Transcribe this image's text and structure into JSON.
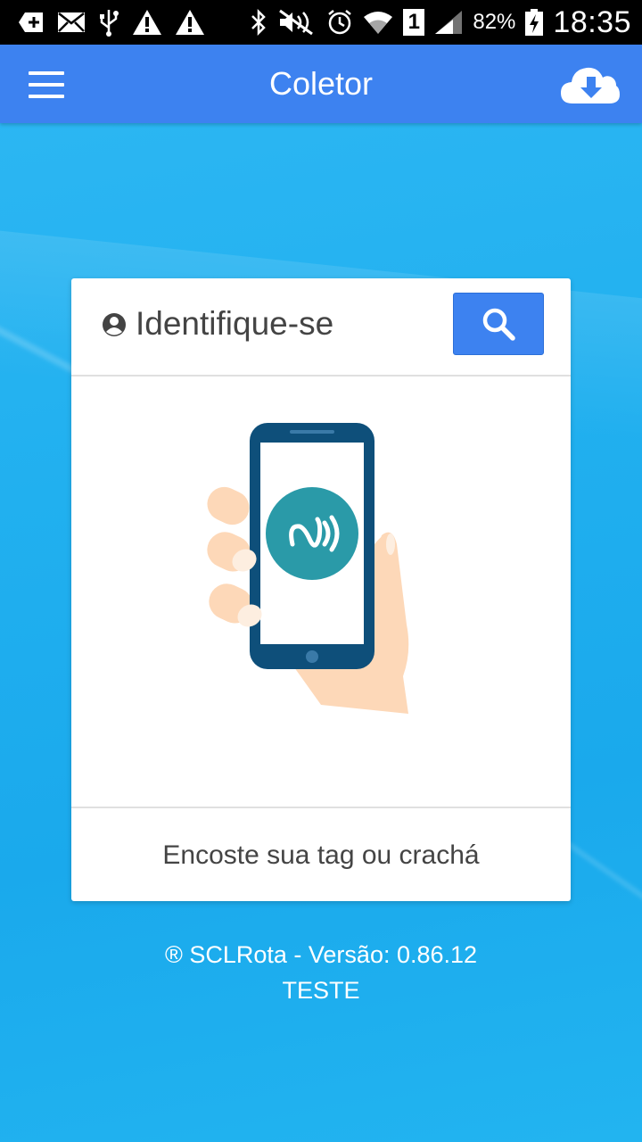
{
  "status_bar": {
    "battery": "82%",
    "time": "18:35",
    "sim": "1",
    "icons": [
      "plus-box-icon",
      "mail-icon",
      "usb-icon",
      "warning-icon",
      "warning-icon",
      "bluetooth-icon",
      "mute-icon",
      "alarm-icon",
      "wifi-icon",
      "signal-icon",
      "battery-charging-icon"
    ]
  },
  "app_bar": {
    "title": "Coletor",
    "menu_icon": "hamburger-menu-icon",
    "action_icon": "cloud-download-icon"
  },
  "card": {
    "title": "Identifique-se",
    "title_icon": "user-circle-icon",
    "search_icon": "search-icon",
    "illustration": "hand-phone-nfc-icon",
    "footer": "Encoste sua tag ou crachá"
  },
  "footer": {
    "version": "® SCLRota - Versão: 0.86.12",
    "environment": "TESTE"
  },
  "colors": {
    "app_bar": "#3d82f0",
    "background": "#1fb0ee",
    "nfc_circle": "#2a9aa8",
    "phone_body": "#0e4f7a",
    "hand": "#fdd8b8"
  }
}
